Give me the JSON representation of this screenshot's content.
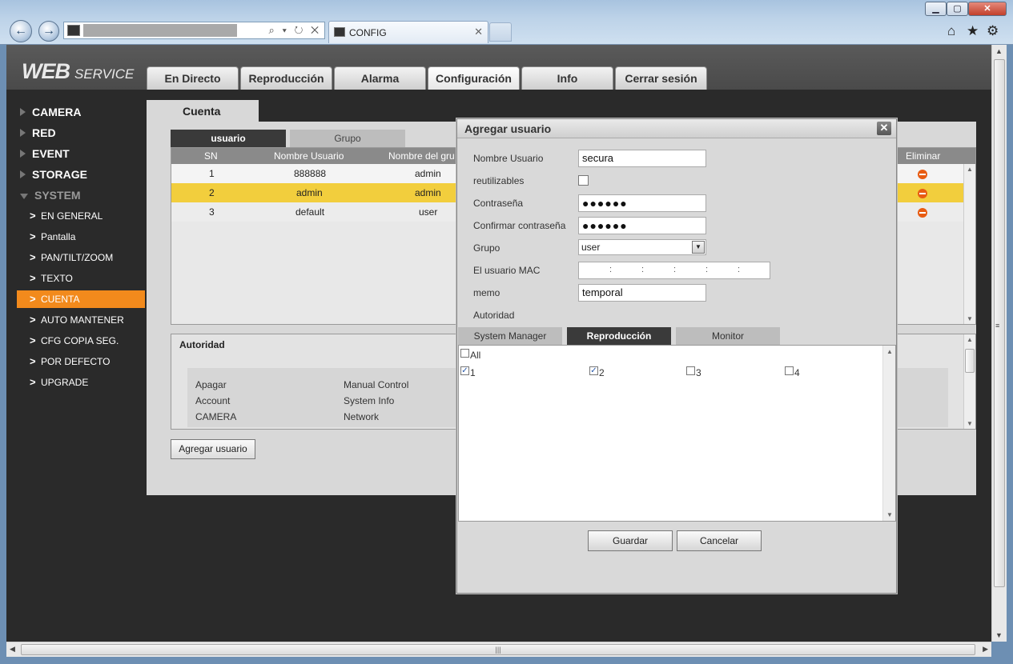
{
  "browser": {
    "tab_title": "CONFIG",
    "win_min": "▁",
    "win_max": "▢",
    "win_close": "✕"
  },
  "app": {
    "logo_web": "WEB",
    "logo_service": "SERVICE",
    "main_tabs": [
      "En Directo",
      "Reproducción",
      "Alarma",
      "Configuración",
      "Info",
      "Cerrar sesión"
    ],
    "active_main_tab": "Configuración"
  },
  "sidebar": {
    "top_items": [
      "CAMERA",
      "RED",
      "EVENT",
      "STORAGE",
      "SYSTEM"
    ],
    "sub_items": [
      "EN GENERAL",
      "Pantalla",
      "PAN/TILT/ZOOM",
      "TEXTO",
      "CUENTA",
      "AUTO MANTENER",
      "CFG COPIA SEG.",
      "POR DEFECTO",
      "UPGRADE"
    ],
    "active_sub": "CUENTA"
  },
  "content": {
    "tab_title": "Cuenta",
    "subtabs": [
      "usuario",
      "Grupo"
    ],
    "table": {
      "headers": [
        "SN",
        "Nombre Usuario",
        "Nombre del gru",
        "Eliminar"
      ],
      "rows": [
        {
          "sn": "1",
          "name": "888888",
          "group": "admin"
        },
        {
          "sn": "2",
          "name": "admin",
          "group": "admin"
        },
        {
          "sn": "3",
          "name": "default",
          "group": "user"
        }
      ],
      "selected_row": 2
    },
    "authority": {
      "title": "Autoridad",
      "items": [
        "Apagar",
        "Account",
        "CAMERA",
        "Manual Control",
        "System Info",
        "Network"
      ]
    },
    "add_user_button": "Agregar usuario"
  },
  "modal": {
    "title": "Agregar usuario",
    "close": "✕",
    "labels": {
      "username": "Nombre Usuario",
      "reusable": "reutilizables",
      "password": "Contraseña",
      "confirm": "Confirmar contraseña",
      "group": "Grupo",
      "mac": "El usuario MAC",
      "memo": "memo",
      "authority": "Autoridad"
    },
    "values": {
      "username": "secura",
      "reusable": false,
      "password": "●●●●●●",
      "confirm": "●●●●●●",
      "group": "user",
      "mac_separator": ":",
      "memo": "temporal"
    },
    "perm_tabs": [
      "System Manager",
      "Reproducción",
      "Monitor"
    ],
    "active_perm_tab": "Reproducción",
    "permissions": {
      "all_label": "All",
      "all_checked": false,
      "channels": [
        {
          "label": "1",
          "checked": true
        },
        {
          "label": "2",
          "checked": true
        },
        {
          "label": "3",
          "checked": false
        },
        {
          "label": "4",
          "checked": false
        }
      ]
    },
    "save": "Guardar",
    "cancel": "Cancelar"
  },
  "icons": {
    "back": "←",
    "forward": "→",
    "home": "⌂",
    "star": "★",
    "gear": "⚙",
    "chevron": ">",
    "check": "✓",
    "arrow_up": "▲",
    "arrow_down": "▼",
    "grip": "≡",
    "addr_tools": "⌕ ▾ ↻ ✕",
    "tab_close": "✕",
    "hscroll_grip": "|||"
  }
}
